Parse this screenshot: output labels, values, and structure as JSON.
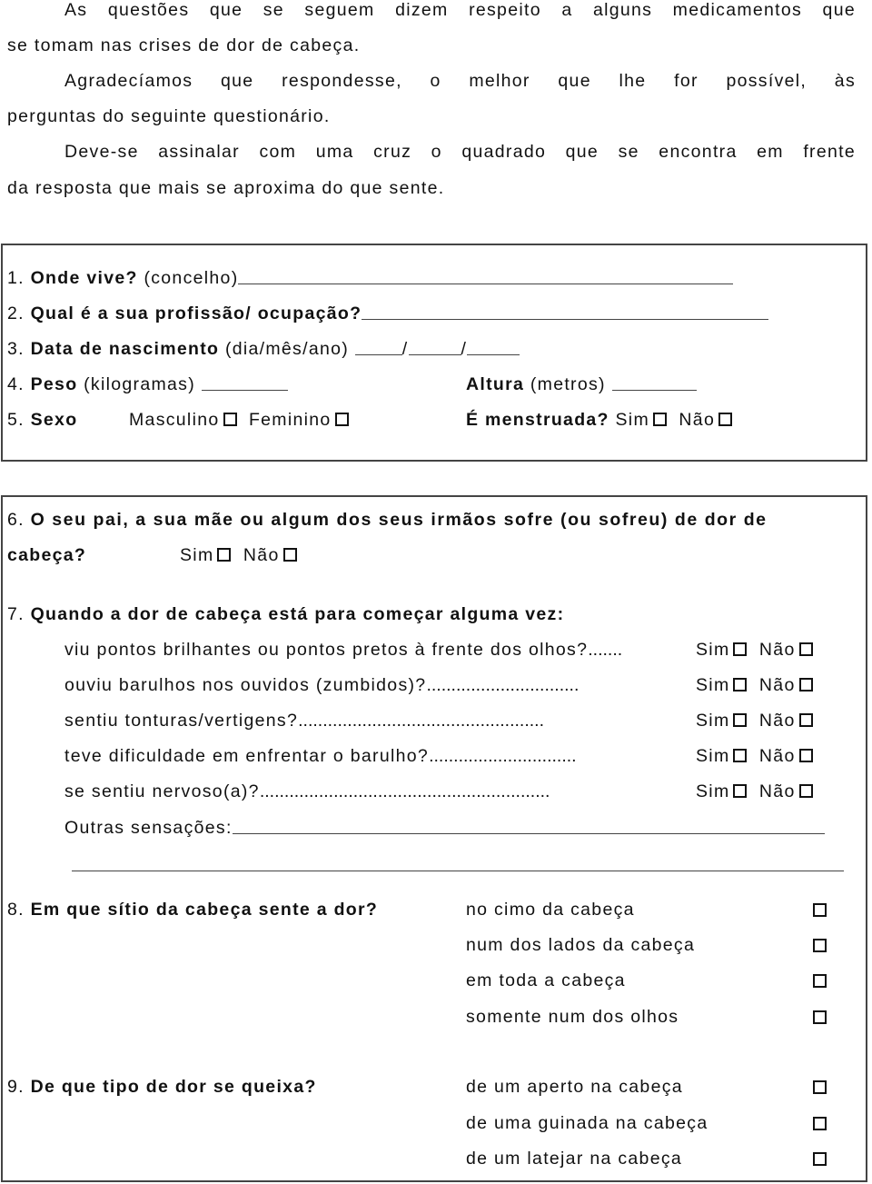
{
  "intro": {
    "p1_line1": "As questões que se seguem dizem respeito a alguns medicamentos que",
    "p1_line2": "se tomam nas crises de dor de cabeça.",
    "p2_line1": "Agradecíamos que respondesse, o melhor que lhe for possível, às",
    "p2_line2": "perguntas do seguinte questionário.",
    "p3_line1": "Deve-se assinalar com uma cruz o quadrado que se encontra em frente",
    "p3_line2": "da resposta que mais se aproxima do que sente."
  },
  "section1": {
    "q1": {
      "num": "1.",
      "label": "Onde vive?",
      "hint": "(concelho)",
      "value": ""
    },
    "q2": {
      "num": "2.",
      "label": "Qual é a sua profissão/ ocupação?",
      "value": ""
    },
    "q3": {
      "num": "3.",
      "label": "Data de nascimento",
      "hint": "(dia/mês/ano)",
      "sep": "/",
      "day": "",
      "month": "",
      "year": ""
    },
    "q4": {
      "num": "4.",
      "label": "Peso",
      "hint": "(kilogramas)",
      "value": "",
      "label2": "Altura",
      "hint2": "(metros)",
      "value2": ""
    },
    "q5": {
      "num": "5.",
      "label": "Sexo",
      "options": [
        "Masculino",
        "Feminino"
      ],
      "label2": "É menstruada?",
      "options2": [
        "Sim",
        "Não"
      ]
    }
  },
  "section2": {
    "q6": {
      "num": "6.",
      "label_line1": "O seu pai, a sua mãe ou algum dos seus irmãos sofre (ou sofreu) de dor de",
      "label_line2": "cabeça?",
      "options": [
        "Sim",
        "Não"
      ]
    },
    "q7": {
      "num": "7.",
      "label": "Quando a dor de cabeça está para começar alguma vez:",
      "items": [
        {
          "text": "viu pontos brilhantes ou pontos pretos à frente dos olhos?",
          "dots": ".......",
          "yes": "Sim",
          "no": "Não"
        },
        {
          "text": "ouviu barulhos nos ouvidos (zumbidos)?",
          "dots": "...............................",
          "yes": "Sim",
          "no": "Não"
        },
        {
          "text": "sentiu tonturas/vertigens?",
          "dots": "..................................................",
          "yes": "Sim",
          "no": "Não"
        },
        {
          "text": "teve dificuldade em enfrentar o barulho?",
          "dots": "..............................",
          "yes": "Sim",
          "no": "Não"
        },
        {
          "text": "se sentiu nervoso(a)?",
          "dots": "...........................................................",
          "yes": "Sim",
          "no": "Não"
        }
      ],
      "other_label": "Outras sensações:",
      "other_value": ""
    },
    "q8": {
      "num": "8.",
      "label": "Em que sítio da cabeça sente a dor?",
      "options": [
        "no cimo da cabeça",
        "num dos lados da cabeça",
        "em toda a cabeça",
        "somente num dos olhos"
      ]
    },
    "q9": {
      "num": "9.",
      "label": "De que tipo de dor se queixa?",
      "options": [
        "de um aperto na cabeça",
        "de uma guinada na cabeça",
        "de um latejar na cabeça"
      ]
    }
  }
}
